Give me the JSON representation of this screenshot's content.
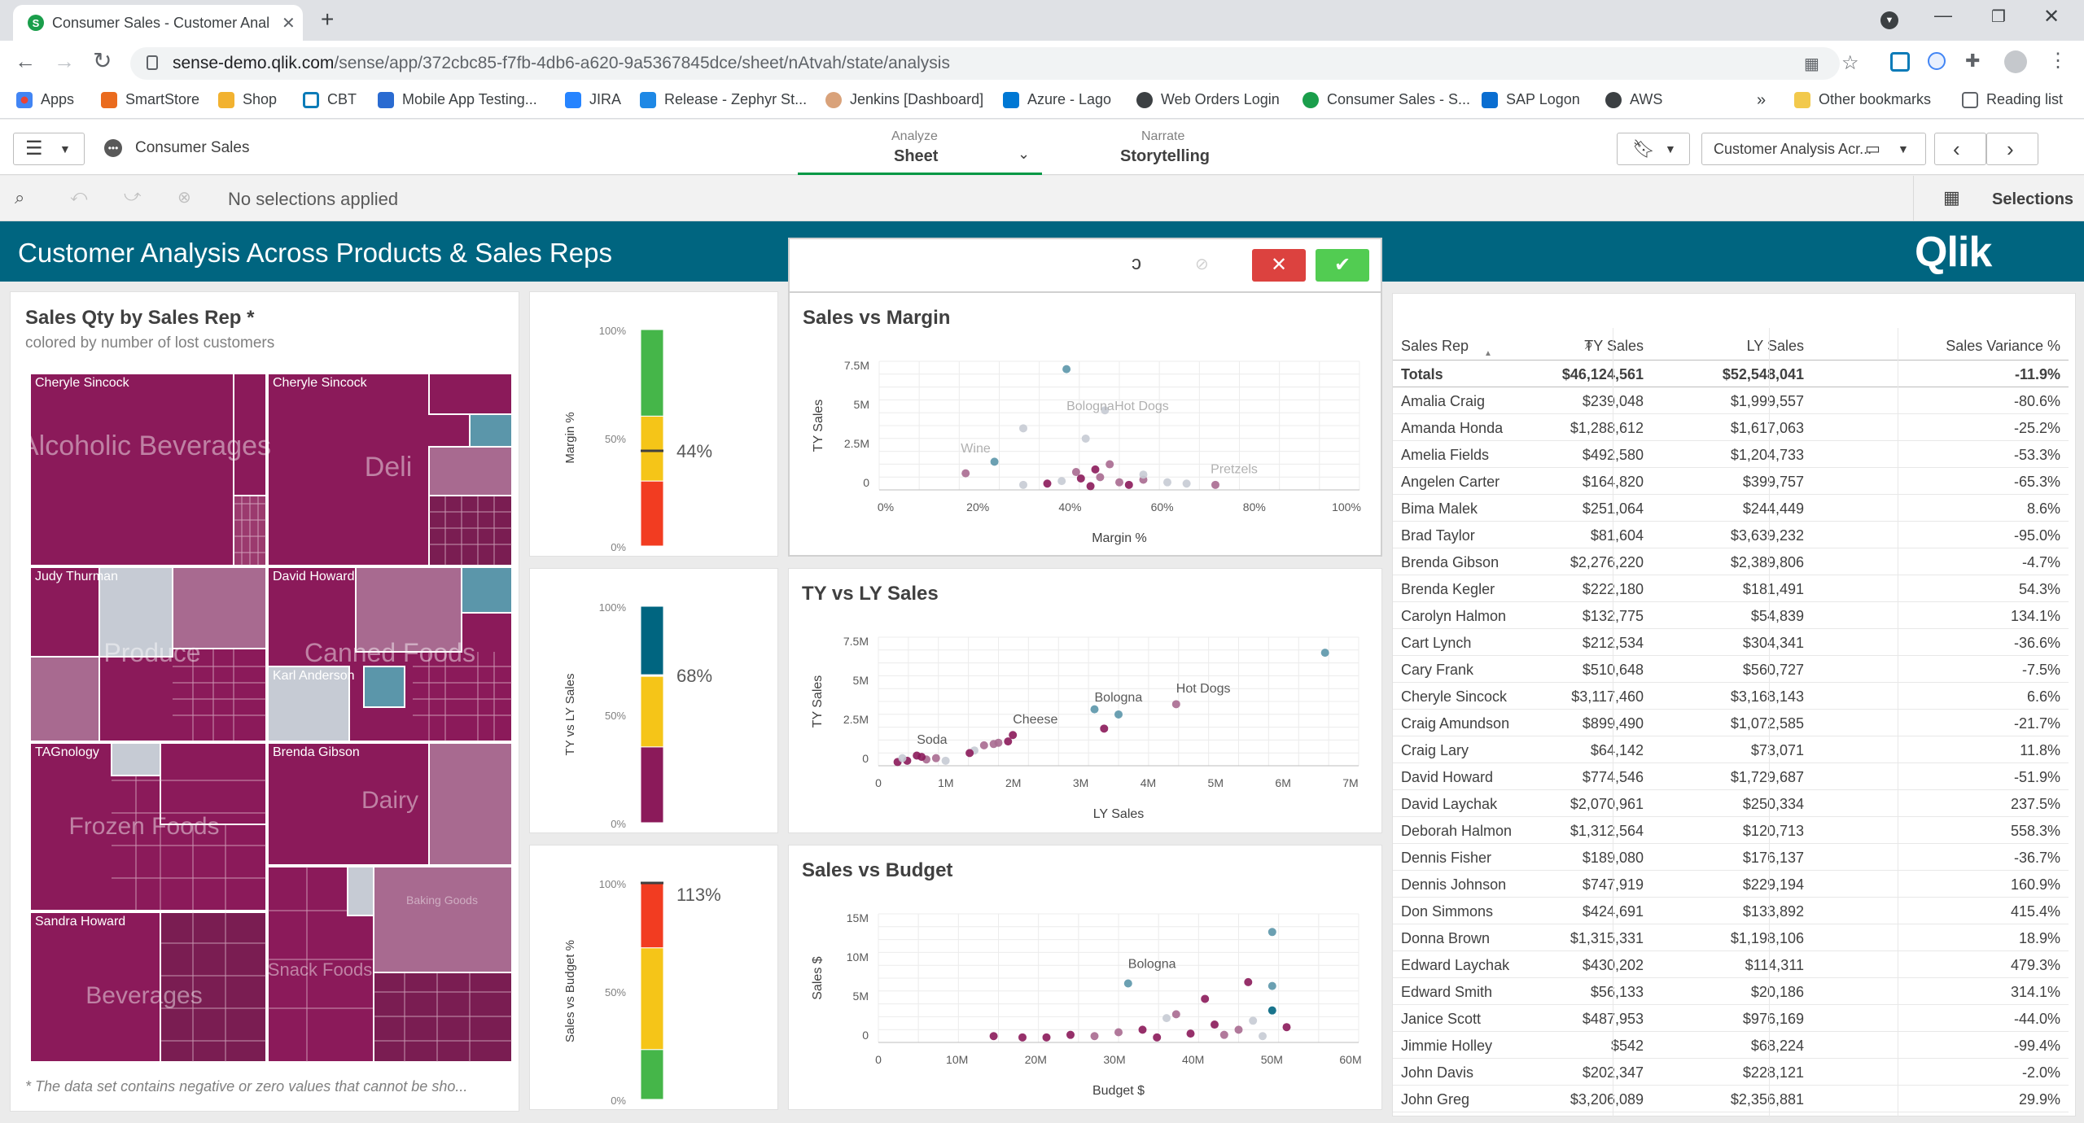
{
  "browser": {
    "tab_title": "Consumer Sales - Customer Anal",
    "url_domain": "sense-demo.qlik.com",
    "url_path": "/sense/app/372cbc85-f7fb-4db6-a620-9a5367845dce/sheet/nAtvah/state/analysis",
    "bookmarks": [
      "Apps",
      "SmartStore",
      "Shop",
      "CBT",
      "Mobile App Testing...",
      "JIRA",
      "Release - Zephyr St...",
      "Jenkins [Dashboard]",
      "Azure - Lago",
      "Web Orders Login",
      "Consumer Sales - S...",
      "SAP Logon",
      "AWS"
    ],
    "overflow": "»",
    "other_bookmarks": "Other bookmarks",
    "reading_list": "Reading list"
  },
  "qlik": {
    "app_name": "Consumer Sales",
    "analyze_label": "Analyze",
    "analyze_value": "Sheet",
    "narrate_label": "Narrate",
    "narrate_value": "Storytelling",
    "sheet_name": "Customer Analysis Acr...",
    "no_selections": "No selections applied",
    "selections": "Selections",
    "banner_title": "Customer Analysis Across Products & Sales Reps",
    "logo": "Qlik"
  },
  "treemap": {
    "title": "Sales Qty by Sales Rep *",
    "subtitle": "colored by number of lost customers",
    "footnote": "* The data set contains negative or zero values that cannot be sho...",
    "reps": [
      "Cheryle Sincock",
      "Cheryle Sincock",
      "Judy Thurman",
      "David Howard",
      "Karl Anderson",
      "TAGnology",
      "Brenda Gibson",
      "Sandra Howard"
    ],
    "categories": [
      "Alcoholic Beverages",
      "Deli",
      "Produce",
      "Canned Foods",
      "Frozen Foods",
      "Dairy",
      "Beverages",
      "Snack Foods",
      "Baking Goods"
    ]
  },
  "gauges": [
    {
      "ylabel": "Margin %",
      "value": "44%",
      "ticks": [
        "100%",
        "50%",
        "0%"
      ]
    },
    {
      "ylabel": "TY vs LY Sales",
      "value": "68%",
      "ticks": [
        "100%",
        "50%",
        "0%"
      ]
    },
    {
      "ylabel": "Sales vs Budget %",
      "value": "113%",
      "ticks": [
        "100%",
        "50%",
        "0%"
      ]
    }
  ],
  "chart_data": [
    {
      "type": "scatter",
      "title": "Sales vs Margin",
      "xlabel": "Margin %",
      "ylabel": "TY Sales",
      "xticks": [
        "0%",
        "20%",
        "40%",
        "60%",
        "80%",
        "100%"
      ],
      "yticks": [
        "7.5M",
        "5M",
        "2.5M",
        "0"
      ],
      "annotations": [
        "Bologna",
        "Hot Dogs",
        "Wine",
        "Pretzels"
      ]
    },
    {
      "type": "scatter",
      "title": "TY vs LY Sales",
      "xlabel": "LY Sales",
      "ylabel": "TY Sales",
      "xticks": [
        "0",
        "1M",
        "2M",
        "3M",
        "4M",
        "5M",
        "6M",
        "7M"
      ],
      "yticks": [
        "7.5M",
        "5M",
        "2.5M",
        "0"
      ],
      "annotations": [
        "Soda",
        "Cheese",
        "Bologna",
        "Hot Dogs"
      ]
    },
    {
      "type": "scatter",
      "title": "Sales vs Budget",
      "xlabel": "Budget $",
      "ylabel": "Sales $",
      "xticks": [
        "0",
        "10M",
        "20M",
        "30M",
        "40M",
        "50M",
        "60M"
      ],
      "yticks": [
        "15M",
        "10M",
        "5M",
        "0"
      ],
      "annotations": [
        "Bologna"
      ]
    }
  ],
  "table": {
    "headers": [
      "Sales Rep",
      "TY Sales",
      "LY Sales",
      "Sales Variance %"
    ],
    "totals": [
      "Totals",
      "$46,124,561",
      "$52,548,041",
      "-11.9%"
    ],
    "rows": [
      [
        "Amalia Craig",
        "$239,048",
        "$1,999,557",
        "-80.6%"
      ],
      [
        "Amanda Honda",
        "$1,288,612",
        "$1,617,063",
        "-25.2%"
      ],
      [
        "Amelia Fields",
        "$492,580",
        "$1,204,733",
        "-53.3%"
      ],
      [
        "Angelen Carter",
        "$164,820",
        "$399,757",
        "-65.3%"
      ],
      [
        "Bima Malek",
        "$251,064",
        "$244,449",
        "8.6%"
      ],
      [
        "Brad Taylor",
        "$81,604",
        "$3,639,232",
        "-95.0%"
      ],
      [
        "Brenda Gibson",
        "$2,276,220",
        "$2,389,806",
        "-4.7%"
      ],
      [
        "Brenda Kegler",
        "$222,180",
        "$181,491",
        "54.3%"
      ],
      [
        "Carolyn Halmon",
        "$132,775",
        "$54,839",
        "134.1%"
      ],
      [
        "Cart Lynch",
        "$212,534",
        "$304,341",
        "-36.6%"
      ],
      [
        "Cary Frank",
        "$510,648",
        "$560,727",
        "-7.5%"
      ],
      [
        "Cheryle Sincock",
        "$3,117,460",
        "$3,168,143",
        "6.6%"
      ],
      [
        "Craig Amundson",
        "$899,490",
        "$1,072,585",
        "-21.7%"
      ],
      [
        "Craig Lary",
        "$64,142",
        "$73,071",
        "11.8%"
      ],
      [
        "David Howard",
        "$774,546",
        "$1,729,687",
        "-51.9%"
      ],
      [
        "David Laychak",
        "$2,070,961",
        "$250,334",
        "237.5%"
      ],
      [
        "Deborah Halmon",
        "$1,312,564",
        "$120,713",
        "558.3%"
      ],
      [
        "Dennis Fisher",
        "$189,080",
        "$176,137",
        "-36.7%"
      ],
      [
        "Dennis Johnson",
        "$747,919",
        "$229,194",
        "160.9%"
      ],
      [
        "Don Simmons",
        "$424,691",
        "$133,892",
        "415.4%"
      ],
      [
        "Donna Brown",
        "$1,315,331",
        "$1,198,106",
        "18.9%"
      ],
      [
        "Edward Laychak",
        "$430,202",
        "$114,311",
        "479.3%"
      ],
      [
        "Edward Smith",
        "$56,133",
        "$20,186",
        "314.1%"
      ],
      [
        "Janice Scott",
        "$487,953",
        "$976,169",
        "-44.0%"
      ],
      [
        "Jimmie Holley",
        "$542",
        "$68,224",
        "-99.4%"
      ],
      [
        "John Davis",
        "$202,347",
        "$228,121",
        "-2.0%"
      ],
      [
        "John Greg",
        "$3,206,089",
        "$2,356,881",
        "29.9%"
      ]
    ]
  }
}
